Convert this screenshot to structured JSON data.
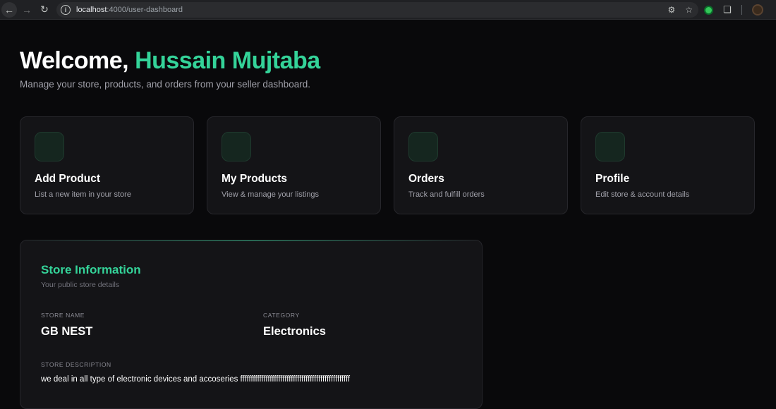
{
  "browser": {
    "url_host": "localhost",
    "url_path": ":4000/user-dashboard"
  },
  "header": {
    "welcome": "Welcome,",
    "user_name": "Hussain Mujtaba",
    "subtitle": "Manage your store, products, and orders from your seller dashboard."
  },
  "cards": [
    {
      "title": "Add Product",
      "description": "List a new item in your store"
    },
    {
      "title": "My Products",
      "description": "View & manage your listings"
    },
    {
      "title": "Orders",
      "description": "Track and fulfill orders"
    },
    {
      "title": "Profile",
      "description": "Edit store & account details"
    }
  ],
  "store": {
    "title": "Store Information",
    "subtitle": "Your public store details",
    "name_label": "STORE NAME",
    "name_value": "GB NEST",
    "category_label": "CATEGORY",
    "category_value": "Electronics",
    "description_label": "STORE DESCRIPTION",
    "description_value": "we deal in all type of electronic devices and accoseries ffffffffffffffffffffffffffffffffffffffffffffffffffff"
  },
  "colors": {
    "accent": "#34d399",
    "background": "#09090b",
    "card": "#141417"
  }
}
